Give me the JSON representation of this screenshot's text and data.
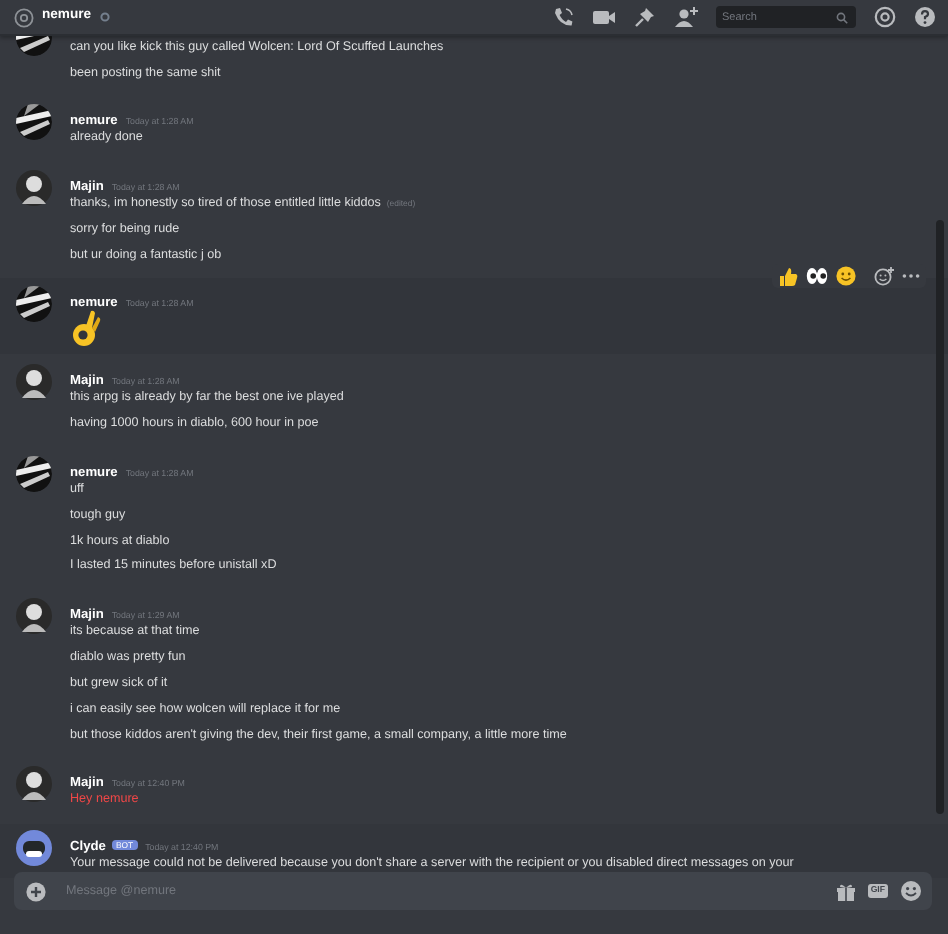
{
  "header": {
    "channel": "nemure",
    "search": {
      "placeholder": "Search"
    }
  },
  "messages": [
    {
      "avatar": {
        "kind": "stripes"
      },
      "hovered": false,
      "lines": [
        {
          "kind": "text",
          "text": "can you like kick this  guy called Wolcen: Lord Of Scuffed Launches"
        },
        {
          "kind": "text",
          "text": "been posting the same shit"
        }
      ]
    },
    {
      "author": "nemure",
      "time": "Today at 1:28 AM",
      "avatar": {
        "kind": "stripes"
      },
      "hovered": false,
      "lines": [
        {
          "kind": "text",
          "text": "already done"
        }
      ]
    },
    {
      "author": "Majin",
      "time": "Today at 1:28 AM",
      "avatar": {
        "kind": "figure"
      },
      "hovered": false,
      "lines": [
        {
          "kind": "text",
          "text": "thanks, im honestly so tired of those entitled little kiddos",
          "suffix": "(edited)"
        },
        {
          "kind": "text",
          "text": "sorry for being rude"
        },
        {
          "kind": "text",
          "text": "but ur doing a fantastic j ob"
        }
      ]
    },
    {
      "author": "nemure",
      "time": "Today at 1:28 AM",
      "avatar": {
        "kind": "stripes"
      },
      "hovered": true,
      "lines": [
        {
          "kind": "emoji"
        }
      ]
    },
    {
      "author": "Majin",
      "time": "Today at 1:28 AM",
      "avatar": {
        "kind": "figure"
      },
      "hovered": false,
      "lines": [
        {
          "kind": "text",
          "text": "this arpg is already by far the best one ive played"
        },
        {
          "kind": "text",
          "text": "having 1000 hours in diablo, 600 hour in poe"
        }
      ]
    },
    {
      "author": "nemure",
      "time": "Today at 1:28 AM",
      "avatar": {
        "kind": "stripes"
      },
      "hovered": false,
      "lines": [
        {
          "kind": "text",
          "text": "uff"
        },
        {
          "kind": "text",
          "text": "tough guy"
        },
        {
          "kind": "text",
          "text": "1k hours at diablo"
        },
        {
          "kind": "text",
          "text": "I lasted 15 minutes before unistall xD"
        }
      ]
    },
    {
      "author": "Majin",
      "time": "Today at 1:29 AM",
      "avatar": {
        "kind": "figure"
      },
      "hovered": false,
      "lines": [
        {
          "kind": "text",
          "text": "its because at that time"
        },
        {
          "kind": "text",
          "text": "diablo was pretty fun"
        },
        {
          "kind": "text",
          "text": "but grew sick of it"
        },
        {
          "kind": "text",
          "text": "i can easily see how wolcen will replace it for me"
        },
        {
          "kind": "text",
          "text": "but those kiddos aren't giving the dev, their first game, a small company, a little more time"
        }
      ]
    },
    {
      "author": "Majin",
      "time": "Today at 12:40 PM",
      "avatar": {
        "kind": "figure"
      },
      "hovered": false,
      "lines": [
        {
          "kind": "failed",
          "text": "Hey nemure"
        }
      ]
    },
    {
      "author": "Clyde",
      "tag": "BOT",
      "time": "Today at 12:40 PM",
      "avatar": {
        "kind": "bot"
      },
      "hovered": false,
      "lines": [
        {
          "kind": "text",
          "text": "Your message could not be delivered because you don't share a server with the recipient or you disabled direct messages on your"
        }
      ]
    }
  ],
  "composer": {
    "placeholder": "Message @nemure",
    "gif": "GIF"
  }
}
